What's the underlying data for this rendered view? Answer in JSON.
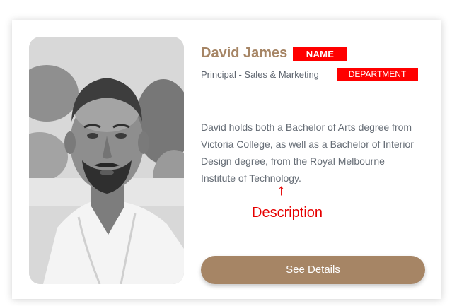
{
  "profile": {
    "name": "David James",
    "name_tag": "NAME",
    "role": "Principal - Sales & Marketing",
    "department_tag": "DEPARTMENT",
    "description": "David holds both a Bachelor of Arts degree from Victoria College, as well as a Bachelor of Interior Design degree, from the Royal Melbourne Institute of Technology.",
    "annotation_arrow": "↑",
    "annotation_label": "Description",
    "button_label": "See Details"
  },
  "colors": {
    "accent": "#a68565",
    "annotation_red": "#e60000",
    "tag_red": "#ff0000",
    "text_gray": "#666d76"
  },
  "icons": {
    "photo": "portrait-photo"
  }
}
